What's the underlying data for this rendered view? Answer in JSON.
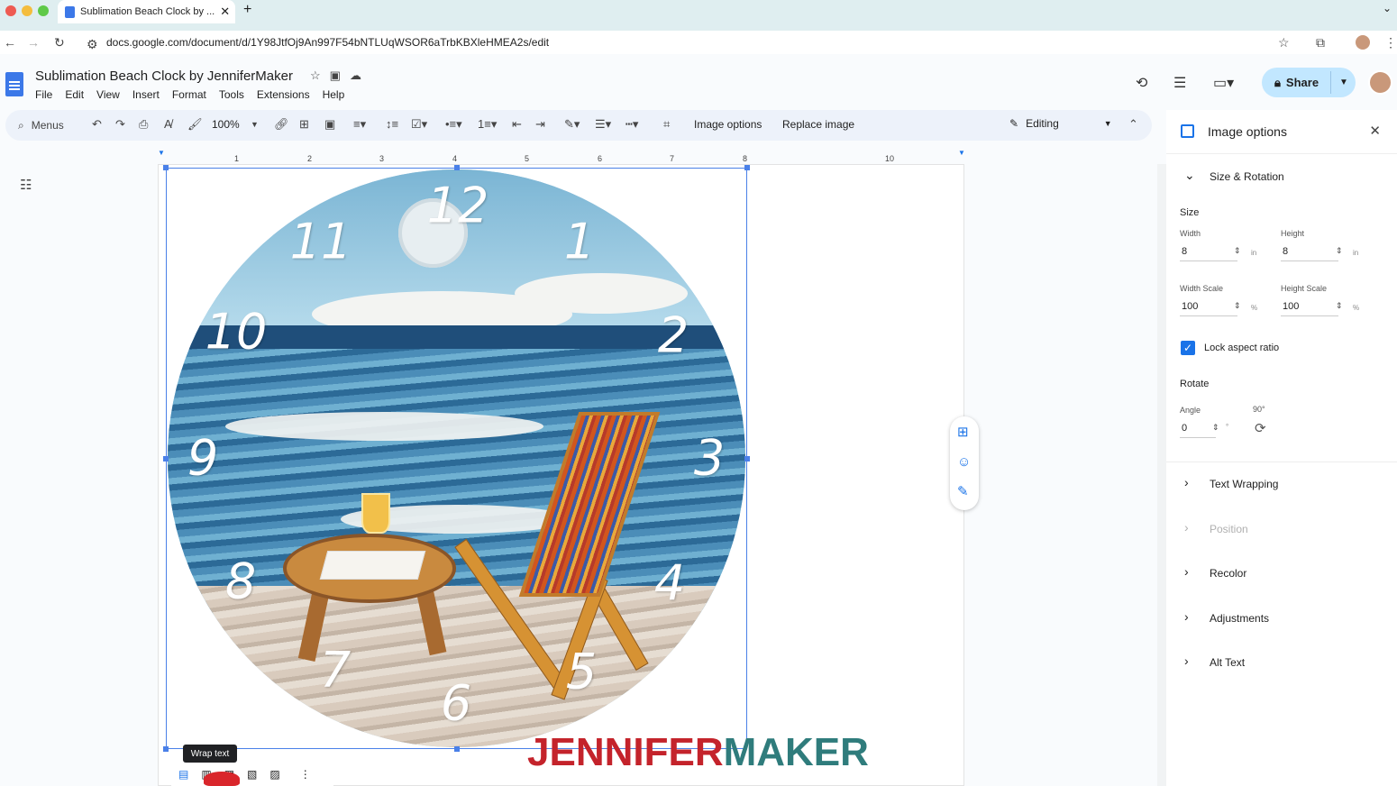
{
  "browser": {
    "tab_title": "Sublimation Beach Clock by ...",
    "url": "docs.google.com/document/d/1Y98JtfOj9An997F54bNTLUqWSOR6aTrbKBXleHMEA2s/edit"
  },
  "doc": {
    "title": "Sublimation Beach Clock by JenniferMaker",
    "menu": [
      "File",
      "Edit",
      "View",
      "Insert",
      "Format",
      "Tools",
      "Extensions",
      "Help"
    ],
    "share_label": "Share"
  },
  "toolbar": {
    "menus_label": "Menus",
    "zoom": "100%",
    "image_options_label": "Image options",
    "replace_image_label": "Replace image",
    "mode_label": "Editing"
  },
  "ruler": [
    "1",
    "2",
    "3",
    "4",
    "5",
    "6",
    "7",
    "8",
    "10"
  ],
  "clock": {
    "numerals": [
      "12",
      "1",
      "2",
      "3",
      "4",
      "5",
      "6",
      "7",
      "8",
      "9",
      "10",
      "11"
    ]
  },
  "image_toolbar": {
    "tooltip": "Wrap text"
  },
  "brand": {
    "part1": "JENNIFER",
    "part2": "MAKER",
    "color1": "#c4232b",
    "color2": "#2f7c7c"
  },
  "panel": {
    "title": "Image options",
    "size_rotation": "Size & Rotation",
    "size_label": "Size",
    "width_label": "Width",
    "width_value": "8",
    "height_label": "Height",
    "height_value": "8",
    "unit_in": "in",
    "width_scale_label": "Width Scale",
    "width_scale_value": "100",
    "height_scale_label": "Height Scale",
    "height_scale_value": "100",
    "unit_pct": "%",
    "lock_label": "Lock aspect ratio",
    "rotate_label": "Rotate",
    "angle_label": "Angle",
    "angle_value": "0",
    "angle_unit": "°",
    "rotate90_label": "90°",
    "sections": [
      "Text Wrapping",
      "Position",
      "Recolor",
      "Adjustments",
      "Alt Text"
    ]
  }
}
